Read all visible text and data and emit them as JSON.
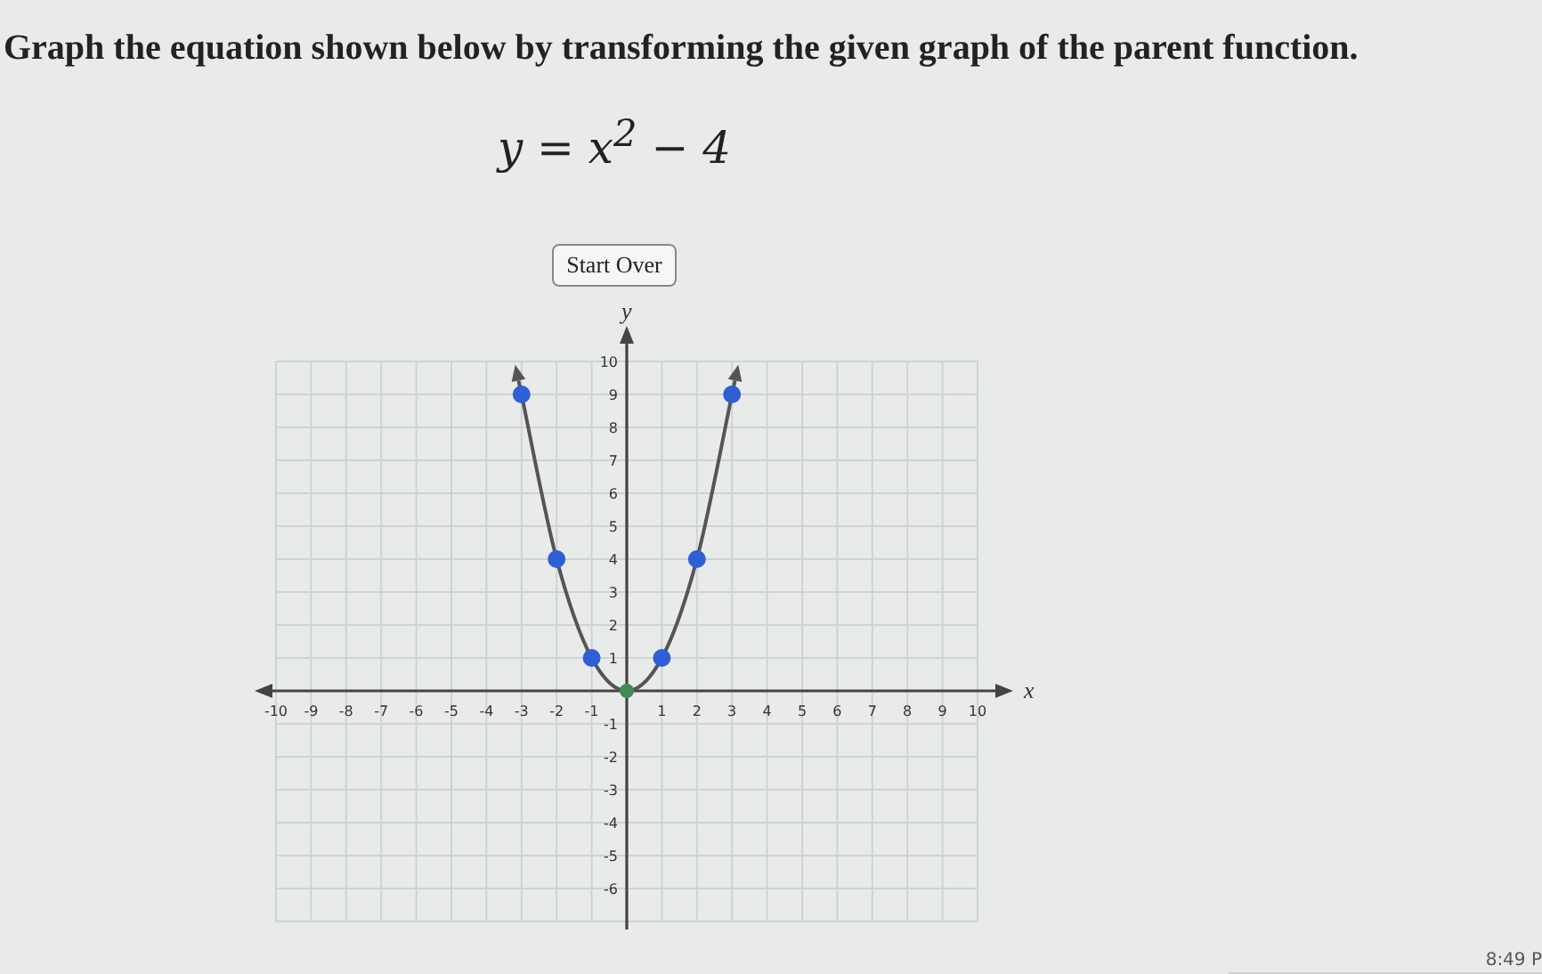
{
  "question": {
    "prompt": "Graph the equation shown below by transforming the given graph of the parent function.",
    "equation": "y = x$^{2}$ − 4"
  },
  "start_over_button": {
    "label": "Start Over"
  },
  "graph": {
    "chart_data": {
      "type": "line",
      "xlabel": "x",
      "ylabel": "y",
      "x": [
        -3,
        -2,
        -1,
        0,
        1,
        2,
        3
      ],
      "series": [
        {
          "color": "#555555",
          "marker": "circle",
          "values": [
            9,
            4,
            1,
            0,
            1,
            4,
            9
          ]
        }
      ],
      "xlim": [
        -10,
        10
      ],
      "ylim": [
        -7,
        10
      ],
      "grid": true,
      "xticks": [
        -10,
        -9,
        -8,
        -7,
        -6,
        -5,
        -4,
        -3,
        -2,
        -1,
        1,
        2,
        3,
        4,
        5,
        6,
        7,
        8,
        9,
        10
      ],
      "yticks": [
        -6,
        -5,
        -4,
        -3,
        -2,
        -1,
        1,
        2,
        3,
        4,
        5,
        6,
        7,
        8,
        9,
        10
      ]
    }
  },
  "clock": {
    "time": "8:49 P"
  }
}
